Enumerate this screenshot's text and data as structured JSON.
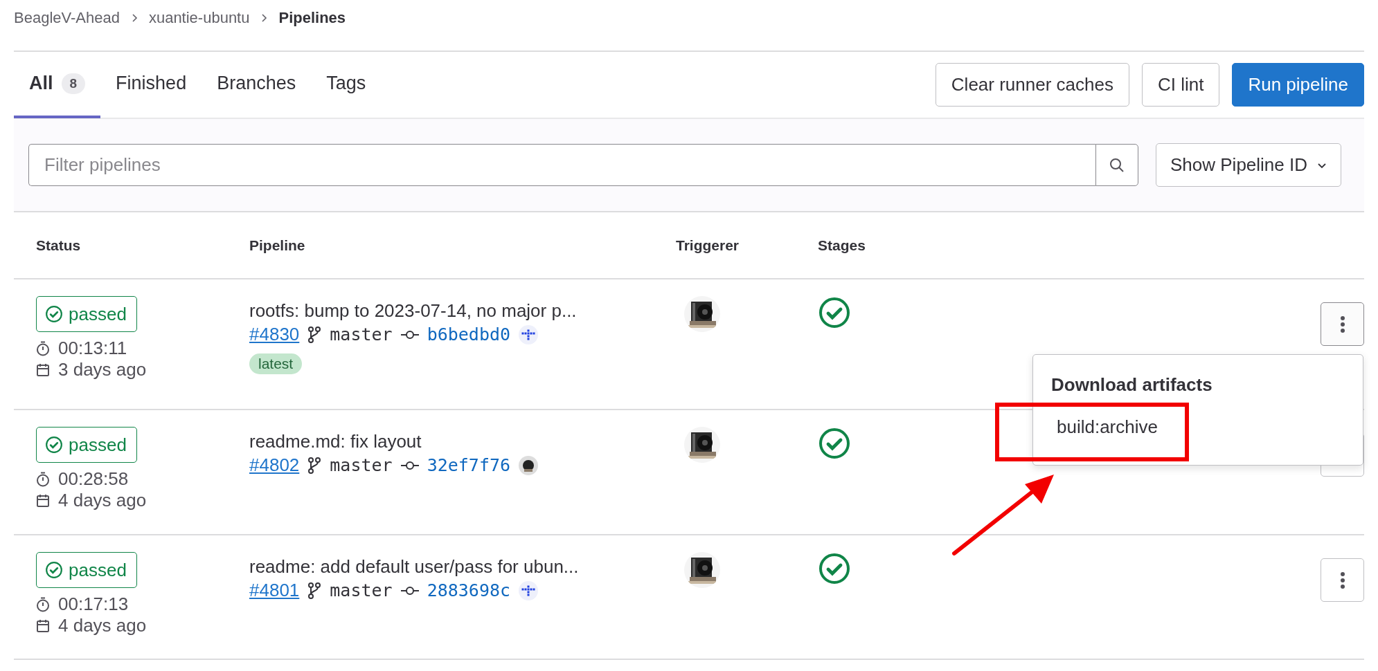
{
  "breadcrumbs": [
    {
      "label": "BeagleV-Ahead",
      "current": false
    },
    {
      "label": "xuantie-ubuntu",
      "current": false
    },
    {
      "label": "Pipelines",
      "current": true
    }
  ],
  "tabs": [
    {
      "label": "All",
      "count": "8",
      "selected": true
    },
    {
      "label": "Finished",
      "selected": false
    },
    {
      "label": "Branches",
      "selected": false
    },
    {
      "label": "Tags",
      "selected": false
    }
  ],
  "actions": [
    {
      "label": "Clear runner caches",
      "kind": "secondary"
    },
    {
      "label": "CI lint",
      "kind": "secondary"
    },
    {
      "label": "Run pipeline",
      "kind": "primary"
    }
  ],
  "filter": {
    "placeholder": "Filter pipelines",
    "sort": "Show Pipeline ID"
  },
  "table": {
    "columns": [
      "Status",
      "Pipeline",
      "Triggerer",
      "Stages"
    ],
    "rows": [
      {
        "status": "passed",
        "duration": "00:13:11",
        "finished": "3 days ago",
        "title": "rootfs: bump to 2023-07-14, no major p...",
        "id": "#4830",
        "ref": "master",
        "commit": "b6bedbd0",
        "commit_avatar": {
          "kind": "identicon"
        },
        "tag": "latest",
        "stage": {
          "kind": "success"
        },
        "menu_open": true
      },
      {
        "status": "passed",
        "duration": "00:28:58",
        "finished": "4 days ago",
        "title": "readme.md: fix layout",
        "id": "#4802",
        "ref": "master",
        "commit": "32ef7f76",
        "stage": {
          "kind": "success"
        },
        "menu_open": false
      },
      {
        "status": "passed",
        "duration": "00:17:13",
        "finished": "4 days ago",
        "title": "readme: add default user/pass for ubun...",
        "id": "#4801",
        "ref": "master",
        "commit": "2883698c",
        "commit_avatar": {
          "kind": "identicon"
        },
        "stage": {
          "kind": "success"
        },
        "menu_open": false
      }
    ]
  },
  "dropdown": {
    "header": "Download artifacts",
    "items": [
      "build:archive"
    ]
  }
}
